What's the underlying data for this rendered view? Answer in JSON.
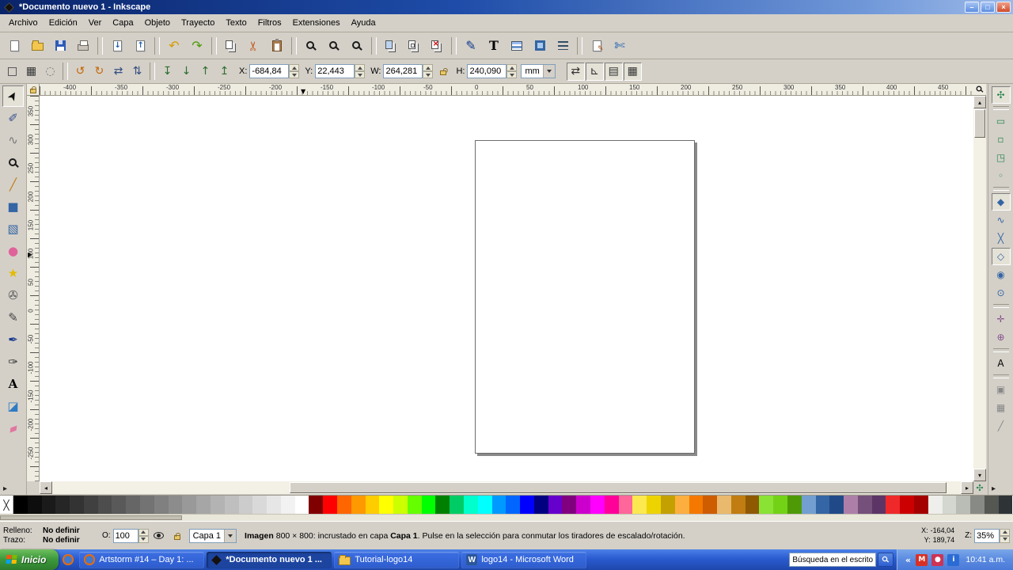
{
  "window": {
    "title": "*Documento nuevo 1 - Inkscape",
    "controls": [
      {
        "name": "minimize-button",
        "glyph": "–"
      },
      {
        "name": "maximize-button",
        "glyph": "□"
      },
      {
        "name": "close-button",
        "glyph": "×"
      }
    ]
  },
  "menu": {
    "items": [
      "Archivo",
      "Edición",
      "Ver",
      "Capa",
      "Objeto",
      "Trayecto",
      "Texto",
      "Filtros",
      "Extensiones",
      "Ayuda"
    ]
  },
  "commands_toolbar": {
    "buttons": [
      {
        "name": "new-document-button",
        "css": "i-page"
      },
      {
        "name": "open-document-button",
        "css": "i-folder"
      },
      {
        "name": "save-button",
        "css": "i-floppy"
      },
      {
        "name": "print-button",
        "css": "i-printer"
      },
      {
        "sep": true
      },
      {
        "name": "import-button",
        "css": "i-page i-import"
      },
      {
        "name": "export-button",
        "css": "i-page i-export"
      },
      {
        "sep": true
      },
      {
        "name": "undo-button",
        "glyph": "↶",
        "color": "#d59c00"
      },
      {
        "name": "redo-button",
        "glyph": "↷",
        "color": "#4e9a06"
      },
      {
        "sep": true
      },
      {
        "name": "copy-button",
        "css": "i-copy"
      },
      {
        "name": "cut-button",
        "glyph": "✂",
        "color": "#c4591d",
        "rotate": -90
      },
      {
        "name": "paste-button",
        "css": "i-paste"
      },
      {
        "sep": true
      },
      {
        "name": "zoom-selection-button",
        "css": "i-zoom"
      },
      {
        "name": "zoom-drawing-button",
        "css": "i-zoom"
      },
      {
        "name": "zoom-page-button",
        "css": "i-zoom"
      },
      {
        "sep": true
      },
      {
        "name": "duplicate-button",
        "css": "i-copy i-dup"
      },
      {
        "name": "clone-button",
        "css": "i-copy i-clone"
      },
      {
        "name": "unlink-clone-button",
        "css": "i-copy i-unlink"
      },
      {
        "sep": true
      },
      {
        "name": "xml-editor-button",
        "glyph": "✎",
        "color": "#123a8c"
      },
      {
        "name": "text-and-font-button",
        "glyph": "T",
        "color": "#000000",
        "serif": true
      },
      {
        "name": "layers-dialog-button",
        "css": "i-layers"
      },
      {
        "name": "fill-and-stroke-button",
        "css": "i-fillstroke"
      },
      {
        "name": "align-distribute-button",
        "css": "i-align"
      },
      {
        "sep": true
      },
      {
        "name": "document-properties-button",
        "css": "i-page i-docprops"
      },
      {
        "name": "preferences-button",
        "glyph": "✄",
        "color": "#1c5fae"
      }
    ]
  },
  "tool_options": {
    "left_buttons": [
      {
        "name": "select-all-button",
        "glyph": "□",
        "color": "#333333"
      },
      {
        "name": "select-all-layers-button",
        "glyph": "▦",
        "color": "#333333"
      },
      {
        "name": "deselect-button",
        "glyph": "◌",
        "color": "#777777"
      },
      {
        "sep": true
      },
      {
        "name": "rotate-ccw-button",
        "glyph": "↺",
        "color": "#c86400"
      },
      {
        "name": "rotate-cw-button",
        "glyph": "↻",
        "color": "#c86400"
      },
      {
        "name": "flip-horizontal-button",
        "glyph": "⇄",
        "color": "#334d80"
      },
      {
        "name": "flip-vertical-button",
        "glyph": "⇅",
        "color": "#334d80"
      },
      {
        "sep": true
      },
      {
        "name": "lower-to-bottom-button",
        "glyph": "↧",
        "color": "#2d6e2d"
      },
      {
        "name": "lower-button",
        "glyph": "↓",
        "color": "#2d6e2d"
      },
      {
        "name": "raise-button",
        "glyph": "↑",
        "color": "#2d6e2d"
      },
      {
        "name": "raise-to-top-button",
        "glyph": "↥",
        "color": "#2d6e2d"
      }
    ],
    "fields": {
      "x_label": "X:",
      "x_value": "-684,84",
      "y_label": "Y:",
      "y_value": "22,443",
      "w_label": "W:",
      "w_value": "264,281",
      "h_label": "H:",
      "h_value": "240,090",
      "unit": "mm"
    },
    "right_buttons": [
      {
        "name": "transform-stroke-toggle",
        "glyph": "⇄",
        "color": "#333333",
        "active": true
      },
      {
        "name": "transform-corners-toggle",
        "glyph": "⊾",
        "color": "#333333",
        "active": true
      },
      {
        "name": "transform-gradients-toggle",
        "glyph": "▤",
        "color": "#333333",
        "active": true
      },
      {
        "name": "transform-patterns-toggle",
        "glyph": "▦",
        "color": "#333333",
        "active": true
      }
    ]
  },
  "rulers": {
    "horizontal_labels": [
      "-400",
      "-350",
      "-300",
      "-250",
      "-200",
      "-150",
      "-100",
      "-50",
      "0",
      "50",
      "100",
      "150",
      "200",
      "250",
      "300",
      "350",
      "400",
      "450"
    ],
    "vertical_labels": [
      "350",
      "300",
      "250",
      "200",
      "150",
      "100",
      "50",
      "0",
      "-50",
      "-100",
      "-150",
      "-200",
      "-250"
    ],
    "marker_h": "▼",
    "marker_v": "▶"
  },
  "toolbox": {
    "tools": [
      {
        "name": "selector-tool",
        "glyph": "➤",
        "color": "#111111",
        "rotate": -60,
        "active": true
      },
      {
        "name": "node-tool",
        "glyph": "✐",
        "color": "#35518c"
      },
      {
        "name": "tweak-tool",
        "glyph": "∿",
        "color": "#777777"
      },
      {
        "name": "zoom-tool",
        "css": "i-zoom"
      },
      {
        "name": "measure-tool",
        "glyph": "╱",
        "color": "#c17d11"
      },
      {
        "name": "rectangle-tool",
        "glyph": "■",
        "color": "#3465a4"
      },
      {
        "name": "box3d-tool",
        "glyph": "▧",
        "color": "#3465a4"
      },
      {
        "name": "ellipse-tool",
        "glyph": "●",
        "color": "#e0629a"
      },
      {
        "name": "star-tool",
        "glyph": "★",
        "color": "#e3bc00"
      },
      {
        "name": "spiral-tool",
        "glyph": "✇",
        "color": "#555555"
      },
      {
        "name": "pencil-tool",
        "glyph": "✎",
        "color": "#444444"
      },
      {
        "name": "pen-tool",
        "glyph": "✒",
        "color": "#1a3b8c"
      },
      {
        "name": "calligraphy-tool",
        "glyph": "✑",
        "color": "#333333"
      },
      {
        "name": "text-tool",
        "glyph": "A",
        "color": "#000000",
        "serif": true
      },
      {
        "name": "paint-bucket-tool",
        "glyph": "◪",
        "color": "#2e7bc4"
      },
      {
        "name": "eraser-tool",
        "glyph": "▰",
        "color": "#e078a0",
        "rotate": -20
      }
    ],
    "expander_glyph": "▸"
  },
  "snapbar": {
    "buttons": [
      {
        "name": "snap-enable-toggle",
        "glyph": "✣",
        "color": "#2d8653",
        "active": true
      },
      {
        "sep": true
      },
      {
        "name": "snap-bbox-toggle",
        "glyph": "▭",
        "color": "#2d8653"
      },
      {
        "name": "snap-bbox-edges-toggle",
        "glyph": "▫",
        "color": "#2d8653"
      },
      {
        "name": "snap-bbox-corners-toggle",
        "glyph": "◳",
        "color": "#2d8653"
      },
      {
        "name": "snap-bbox-midpoints-toggle",
        "glyph": "◦",
        "color": "#2d8653"
      },
      {
        "sep": true
      },
      {
        "name": "snap-nodes-toggle",
        "glyph": "◆",
        "color": "#3465a4",
        "active": true
      },
      {
        "name": "snap-paths-toggle",
        "glyph": "∿",
        "color": "#3465a4"
      },
      {
        "name": "snap-intersections-toggle",
        "glyph": "╳",
        "color": "#3465a4"
      },
      {
        "name": "snap-cusp-nodes-toggle",
        "glyph": "◇",
        "color": "#3465a4",
        "active": true
      },
      {
        "name": "snap-smooth-nodes-toggle",
        "glyph": "◉",
        "color": "#3465a4"
      },
      {
        "name": "snap-midpoints-toggle",
        "glyph": "⊙",
        "color": "#3465a4"
      },
      {
        "sep": true
      },
      {
        "name": "snap-object-centers-toggle",
        "glyph": "✛",
        "color": "#87518c"
      },
      {
        "name": "snap-rotation-centers-toggle",
        "glyph": "⊕",
        "color": "#87518c"
      },
      {
        "sep": true
      },
      {
        "name": "snap-text-baseline-toggle",
        "glyph": "A",
        "color": "#000000"
      },
      {
        "sep": true
      },
      {
        "name": "snap-page-border-toggle",
        "glyph": "▣",
        "color": "#888888"
      },
      {
        "name": "snap-grid-toggle",
        "glyph": "▦",
        "color": "#888888"
      },
      {
        "name": "snap-guides-toggle",
        "glyph": "╱",
        "color": "#888888"
      }
    ],
    "expander_glyph": "▸",
    "corner_glyph": "✣"
  },
  "scroll": {
    "left": "◂",
    "right": "▸",
    "up": "▴",
    "down": "▾"
  },
  "palette": {
    "none_glyph": "╳",
    "colors": [
      "#000000",
      "#0d0d0d",
      "#1a1a1a",
      "#262626",
      "#333333",
      "#404040",
      "#4d4d4d",
      "#595959",
      "#666666",
      "#737373",
      "#808080",
      "#8c8c8c",
      "#999999",
      "#a6a6a6",
      "#b3b3b3",
      "#bfbfbf",
      "#cccccc",
      "#d9d9d9",
      "#e6e6e6",
      "#f2f2f2",
      "#ffffff",
      "#800000",
      "#ff0000",
      "#ff6600",
      "#ff9900",
      "#ffcc00",
      "#ffff00",
      "#ccff00",
      "#66ff00",
      "#00ff00",
      "#008000",
      "#00cc66",
      "#00ffcc",
      "#00ffff",
      "#0099ff",
      "#0066ff",
      "#0000ff",
      "#000080",
      "#6600cc",
      "#800080",
      "#cc00cc",
      "#ff00ff",
      "#ff0099",
      "#ff6699",
      "#fce94f",
      "#edd400",
      "#c4a000",
      "#fcaf3e",
      "#f57900",
      "#ce5c00",
      "#e9b96e",
      "#c17d11",
      "#8f5902",
      "#8ae234",
      "#73d216",
      "#4e9a06",
      "#729fcf",
      "#3465a4",
      "#204a87",
      "#ad7fa8",
      "#75507b",
      "#5c3566",
      "#ef2929",
      "#cc0000",
      "#a40000",
      "#eeeeec",
      "#d3d7cf",
      "#babdb6",
      "#888a85",
      "#555753",
      "#2e3436"
    ]
  },
  "statusbar": {
    "fill_label": "Relleno:",
    "fill_value": "No definir",
    "stroke_label": "Trazo:",
    "stroke_value": "No definir",
    "opacity_label": "O:",
    "opacity_value": "100",
    "layer_label": "Capa 1",
    "message_parts": [
      {
        "text": "Imagen",
        "bold": true
      },
      {
        "text": " 800 × 800: incrustado en capa ",
        "bold": false
      },
      {
        "text": "Capa 1",
        "bold": true
      },
      {
        "text": ". Pulse en la selección para conmutar los tiradores de escalado/rotación.",
        "bold": false
      }
    ],
    "cursor_x_label": "X:",
    "cursor_x": "-164,04",
    "cursor_y_label": "Y:",
    "cursor_y": "189,74",
    "zoom_label": "Z:",
    "zoom_value": "35%"
  },
  "taskbar": {
    "start_label": "Inicio",
    "tasks": [
      {
        "label": "Artstorm #14 – Day 1: ...",
        "icon": "firefox",
        "active": false
      },
      {
        "label": "*Documento nuevo 1 ...",
        "icon": "inkscape",
        "active": true
      },
      {
        "label": "Tutorial-logo14",
        "icon": "folder",
        "active": false
      },
      {
        "label": "logo14 - Microsoft Word",
        "icon": "word",
        "glyph": "W",
        "active": false
      }
    ],
    "search_value": "Búsqueda en el escritorio",
    "tray_icons": [
      {
        "name": "tray-hide-button",
        "glyph": "«",
        "plain": true
      },
      {
        "name": "tray-mail-icon",
        "glyph": "M",
        "bg": "#d93025"
      },
      {
        "name": "tray-messenger-icon",
        "glyph": "●",
        "bg": "#cc3355"
      },
      {
        "name": "tray-info-icon",
        "glyph": "i",
        "bg": "#2b6cd4"
      }
    ],
    "clock": "10:41 a.m."
  }
}
